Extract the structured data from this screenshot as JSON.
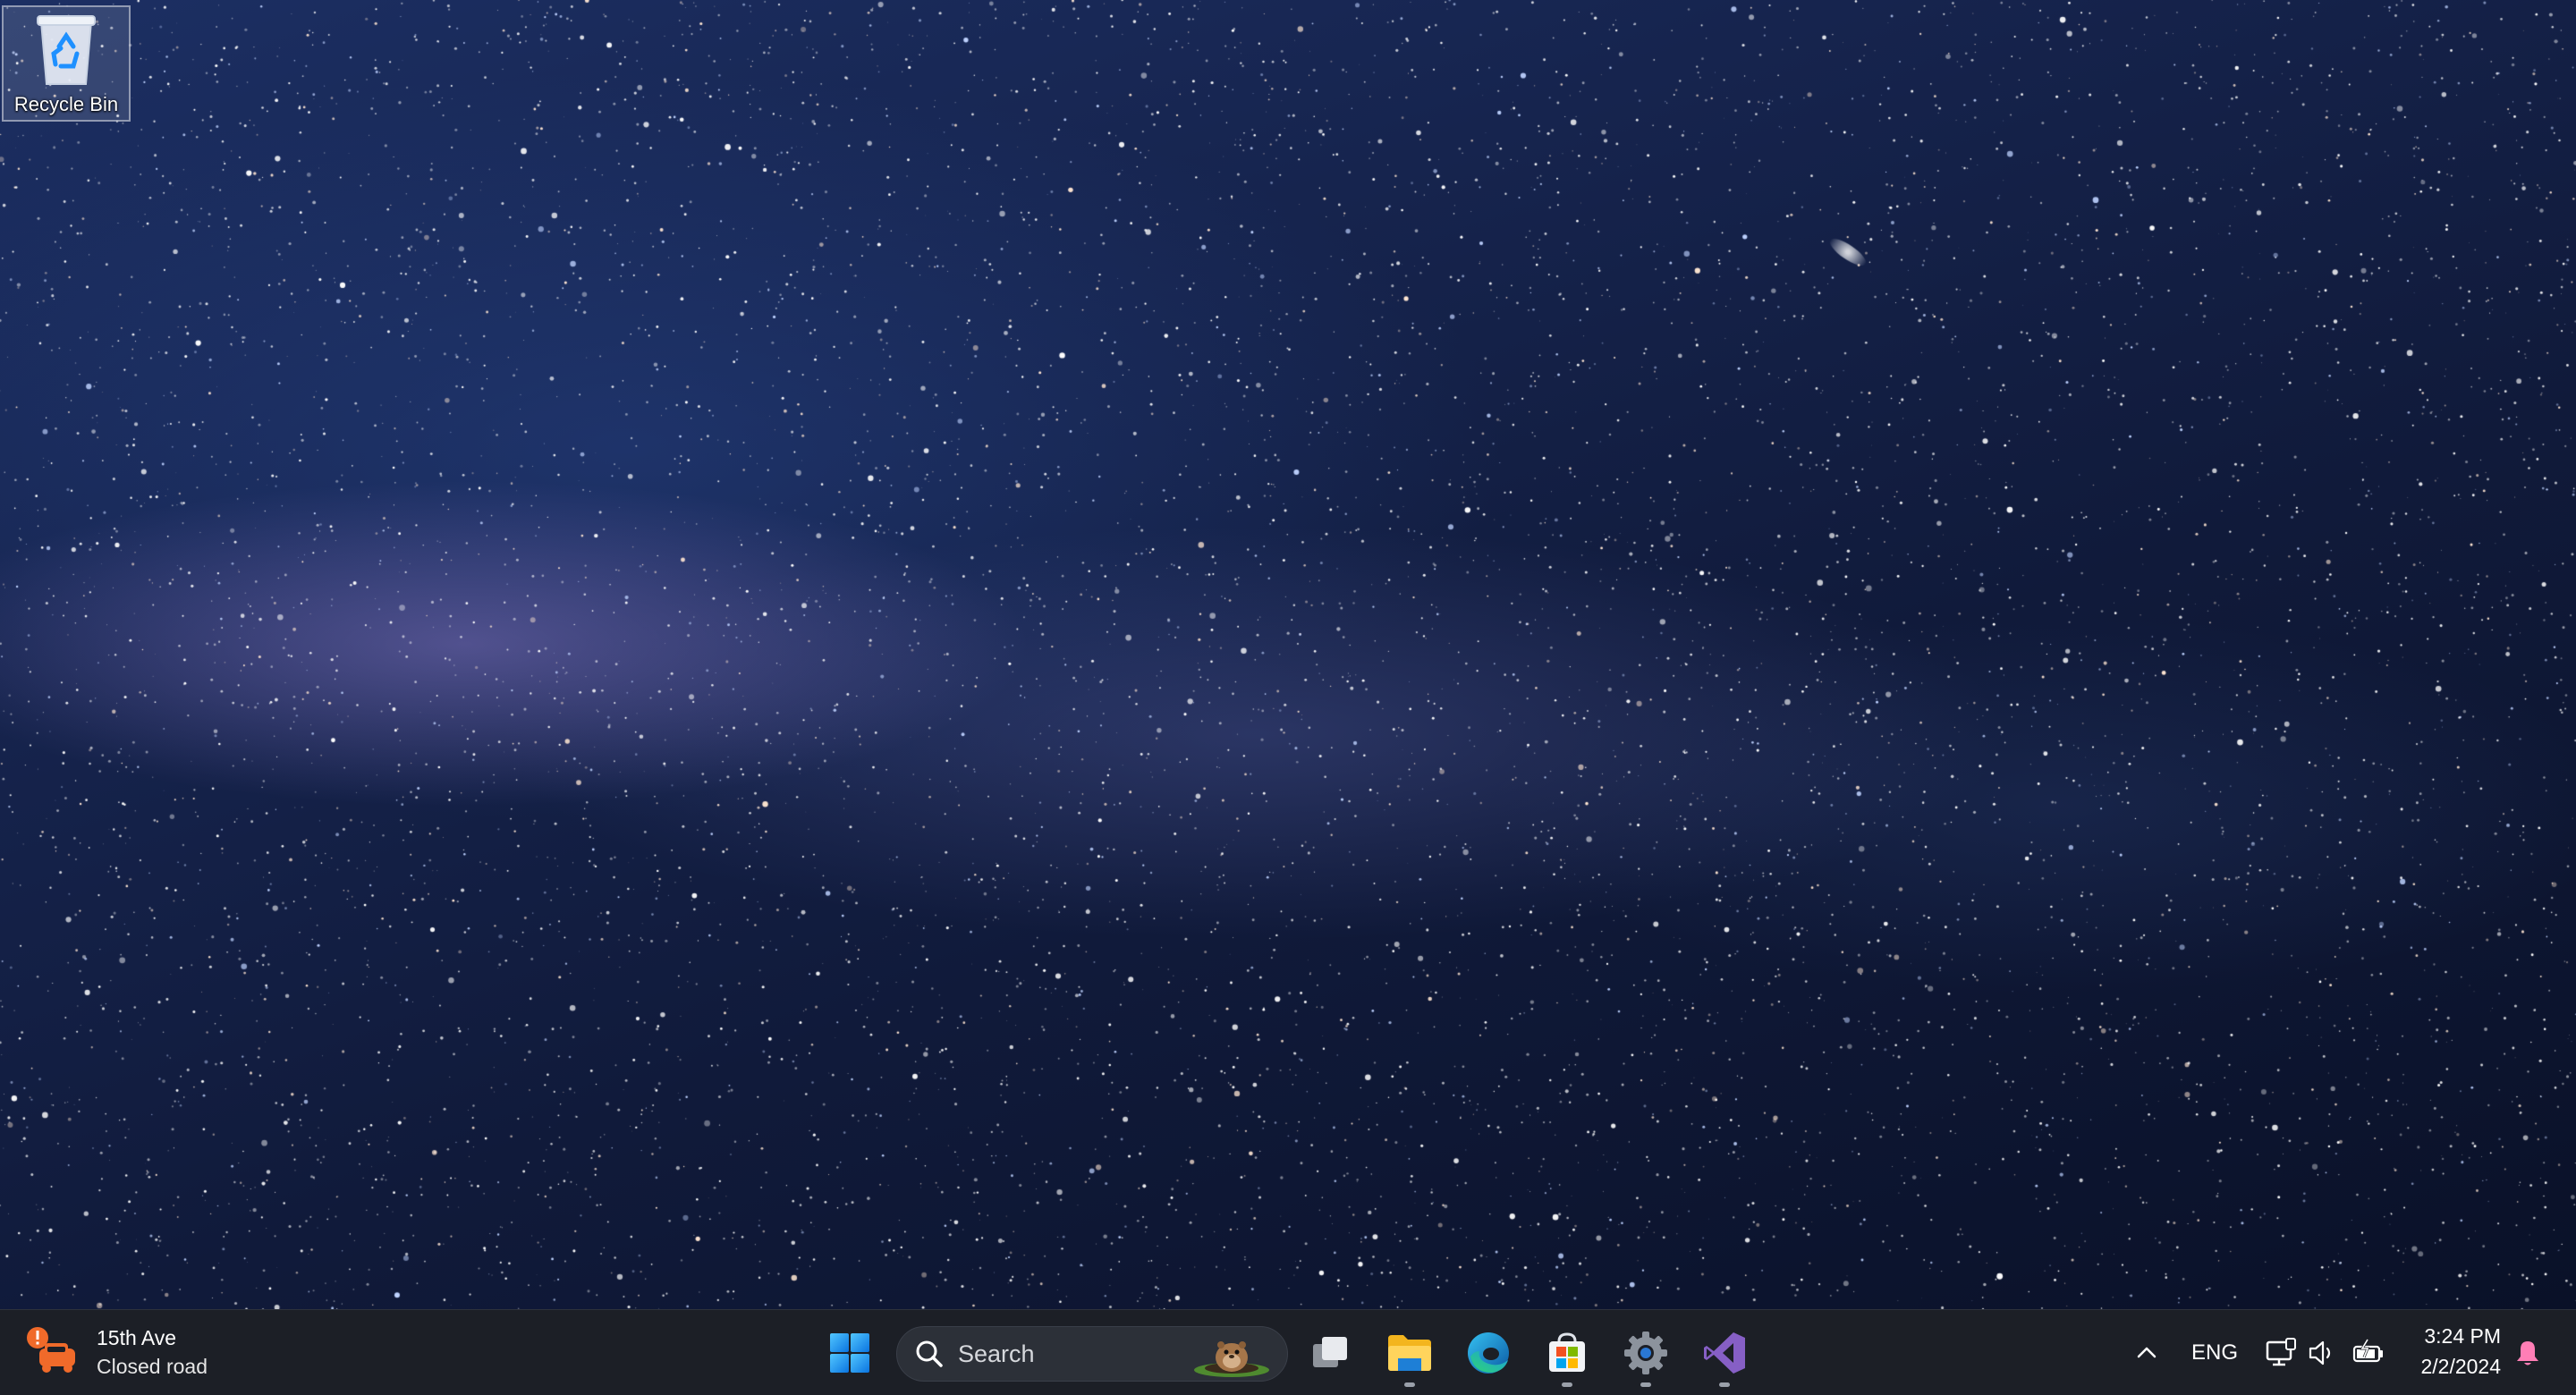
{
  "desktop": {
    "icons": [
      {
        "label": "Recycle Bin",
        "icon": "recycle-bin-icon"
      }
    ]
  },
  "taskbar": {
    "widget": {
      "icon": "traffic-alert-icon",
      "line1": "15th Ave",
      "line2": "Closed road"
    },
    "start_icon": "windows-start-icon",
    "search": {
      "placeholder": "Search",
      "icon": "search-icon"
    },
    "pinned_apps": [
      {
        "name": "Task View",
        "icon": "task-view-icon",
        "running": false
      },
      {
        "name": "File Explorer",
        "icon": "file-explorer-icon",
        "running": true
      },
      {
        "name": "Microsoft Edge",
        "icon": "edge-icon",
        "running": false
      },
      {
        "name": "Microsoft Store",
        "icon": "store-icon",
        "running": true
      },
      {
        "name": "Settings",
        "icon": "settings-icon",
        "running": true
      },
      {
        "name": "Visual Studio",
        "icon": "visual-studio-icon",
        "running": true
      }
    ],
    "tray": {
      "language": "ENG",
      "time": "3:24 PM",
      "date": "2/2/2024"
    }
  },
  "colors": {
    "taskbar_bg": "#1c1f26",
    "accent_blue": "#1e90ff",
    "alert_orange": "#f06a2a",
    "vs_purple": "#865fc5"
  }
}
